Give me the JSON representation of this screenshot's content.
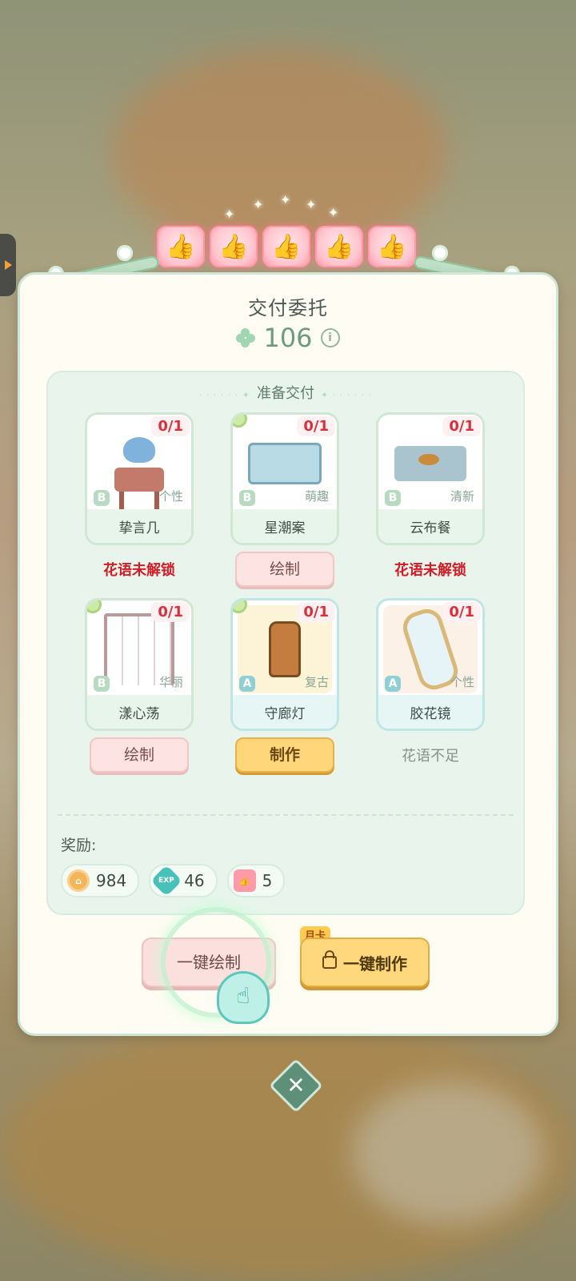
{
  "dialog": {
    "title": "交付委托",
    "score": "106",
    "section_title": "准备交付",
    "reward_label": "奖励:"
  },
  "items": [
    {
      "name": "挚言几",
      "count": "0/1",
      "grade": "B",
      "style": "个性",
      "status": "花语未解锁",
      "status_type": "text-red"
    },
    {
      "name": "星潮案",
      "count": "0/1",
      "grade": "B",
      "style": "萌趣",
      "status": "绘制",
      "status_type": "button-pink"
    },
    {
      "name": "云布餐",
      "count": "0/1",
      "grade": "B",
      "style": "清新",
      "status": "花语未解锁",
      "status_type": "text-red"
    },
    {
      "name": "漾心荡",
      "count": "0/1",
      "grade": "B",
      "style": "华丽",
      "status": "绘制",
      "status_type": "button-pink"
    },
    {
      "name": "守廊灯",
      "count": "0/1",
      "grade": "A",
      "style": "复古",
      "status": "制作",
      "status_type": "button-yellow"
    },
    {
      "name": "胶花镜",
      "count": "0/1",
      "grade": "A",
      "style": "个性",
      "status": "花语不足",
      "status_type": "text-grey"
    }
  ],
  "rewards": [
    {
      "icon": "coin-icon",
      "value": "984"
    },
    {
      "icon": "exp-icon",
      "label": "EXP",
      "value": "46"
    },
    {
      "icon": "like-icon",
      "value": "5"
    }
  ],
  "actions": {
    "draw_all": "一键绘制",
    "make_all": "一键制作",
    "month_badge": "月卡"
  },
  "colors": {
    "accent_green": "#6b9b80",
    "status_red": "#d21d26",
    "button_yellow": "#ffd67a",
    "button_pink": "#fde3e2"
  }
}
